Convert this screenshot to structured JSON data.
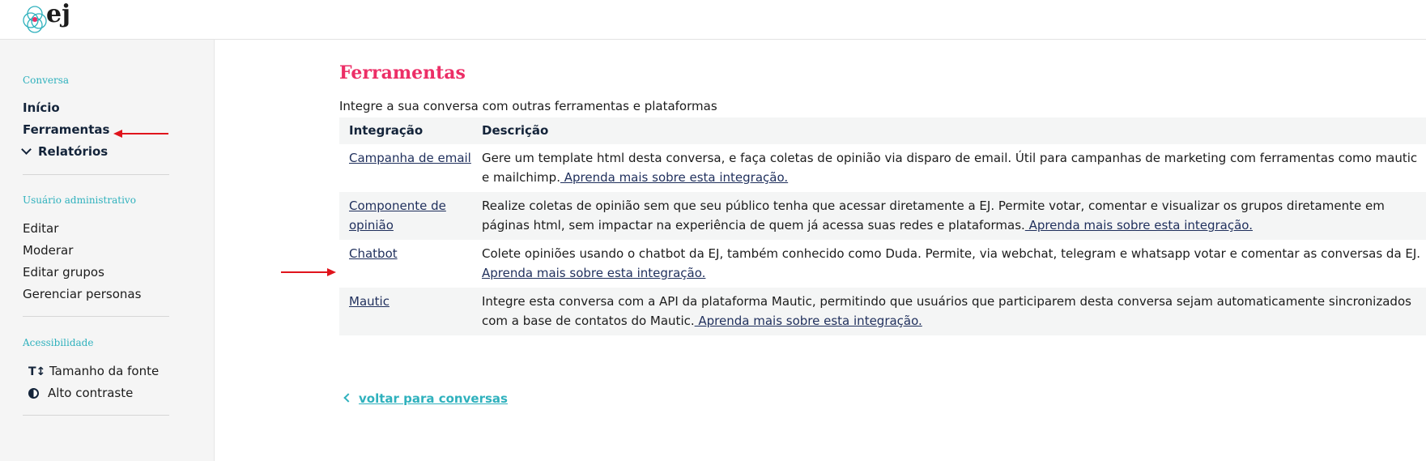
{
  "brand": {
    "name": "ej"
  },
  "sidebar": {
    "sections": [
      {
        "heading": "Conversa",
        "items": [
          "Início",
          "Ferramentas",
          "Relatórios"
        ]
      },
      {
        "heading": "Usuário administrativo",
        "items": [
          "Editar",
          "Moderar",
          "Editar grupos",
          "Gerenciar personas"
        ]
      },
      {
        "heading": "Acessibilidade",
        "items": [
          "Tamanho da fonte",
          "Alto contraste"
        ]
      }
    ]
  },
  "main": {
    "title": "Ferramentas",
    "subtitle": "Integre a sua conversa com outras ferramentas e plataformas",
    "table": {
      "headers": [
        "Integração",
        "Descrição"
      ],
      "rows": [
        {
          "name": "Campanha de email",
          "description": "Gere um template html desta conversa, e faça coletas de opinião via disparo de email. Útil para campanhas de marketing com ferramentas como mautic e mailchimp.",
          "link": " Aprenda mais sobre esta integração."
        },
        {
          "name": "Componente de opinião",
          "description": "Realize coletas de opinião sem que seu público tenha que acessar diretamente a EJ. Permite votar, comentar e visualizar os grupos diretamente em páginas html, sem impactar na experiência de quem já acessa suas redes e plataformas.",
          "link": " Aprenda mais sobre esta integração."
        },
        {
          "name": "Chatbot",
          "description": "Colete opiniões usando o chatbot da EJ, também conhecido como Duda. Permite, via webchat, telegram e whatsapp votar e comentar as conversas da EJ.",
          "link": "Aprenda mais sobre esta integração."
        },
        {
          "name": "Mautic",
          "description": "Integre esta conversa com a API da plataforma Mautic, permitindo que usuários que participarem desta conversa sejam automaticamente sincronizados com a base de contatos do Mautic.",
          "link": " Aprenda mais sobre esta integração."
        }
      ]
    },
    "back_link": "voltar para conversas"
  },
  "colors": {
    "accent_pink": "#ec2e66",
    "accent_teal": "#2fb1bd",
    "annotation_red": "#e0141c"
  },
  "icons": [
    "logo-icon",
    "chevron-down-icon",
    "text-size-icon",
    "contrast-icon",
    "chevron-left-icon",
    "red-arrow-annotation"
  ]
}
